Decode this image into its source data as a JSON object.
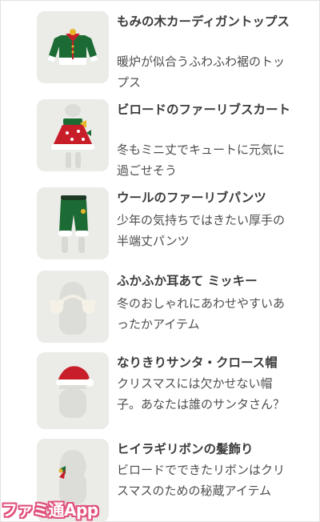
{
  "items": [
    {
      "title": "もみの木カーディガントップス",
      "desc": "暖炉が似合うふわふわ裾のトップス",
      "icon": "green-cardigan-icon"
    },
    {
      "title": "ビロードのファーリブスカート",
      "desc": "冬もミニ丈でキュートに元気に過ごせそう",
      "icon": "red-skirt-icon"
    },
    {
      "title": "ウールのファーリブパンツ",
      "desc": "少年の気持ちではきたい厚手の半端丈パンツ",
      "icon": "green-pants-icon"
    },
    {
      "title": "ふかふか耳あて ミッキー",
      "desc": "冬のおしゃれにあわせやすいあったかアイテム",
      "icon": "earmuffs-icon"
    },
    {
      "title": "なりきりサンタ・クロース帽",
      "desc": "クリスマスには欠かせない帽子。あなたは誰のサンタさん？",
      "icon": "santa-hat-icon"
    },
    {
      "title": "ヒイラギリボンの髪飾り",
      "desc": "ビロードでできたリボンはクリスマスのための秘蔵アイテム",
      "icon": "holly-ribbon-icon"
    }
  ],
  "watermark": "ファミ通App"
}
